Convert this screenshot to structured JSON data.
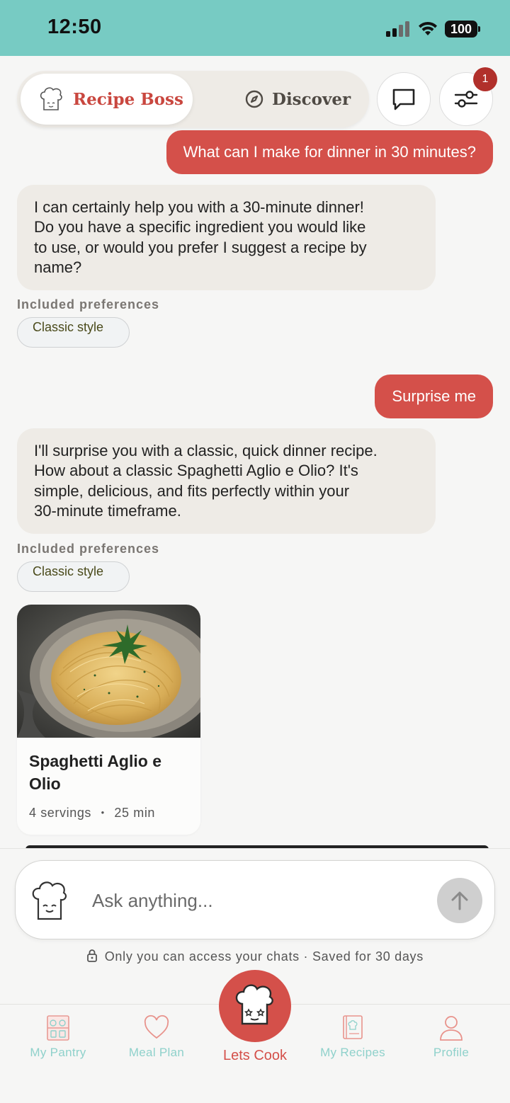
{
  "status_bar": {
    "time": "12:50",
    "battery": "100"
  },
  "header": {
    "tabs": [
      {
        "label": "Recipe Boss",
        "active": true,
        "icon": "chef-hat-icon"
      },
      {
        "label": "Discover",
        "active": false,
        "icon": "compass-icon"
      }
    ],
    "chat_button_icon": "chat-bubble-icon",
    "filter_button_icon": "sliders-icon",
    "filter_badge": "1"
  },
  "conversation": [
    {
      "role": "user",
      "text": "What can I make for dinner in 30 minutes?"
    },
    {
      "role": "assistant",
      "lines": [
        "I can certainly help you with a 30-minute dinner!",
        "Do you have a specific ingredient you would like",
        "to use, or would you prefer I suggest a recipe by",
        "name?"
      ],
      "preferences_title": "Included preferences",
      "preferences": [
        "Classic style"
      ]
    },
    {
      "role": "user",
      "text": "Surprise me"
    },
    {
      "role": "assistant",
      "lines": [
        "I'll surprise you with a classic, quick dinner recipe.",
        "How about a classic Spaghetti Aglio e Olio? It's",
        "simple, delicious, and fits perfectly within your",
        "30-minute timeframe."
      ],
      "preferences_title": "Included preferences",
      "preferences": [
        "Classic style"
      ]
    }
  ],
  "recipe_card": {
    "title": "Spaghetti Aglio e Olio",
    "servings": "4 servings",
    "separator": "•",
    "time": "25 min"
  },
  "composer": {
    "placeholder": "Ask anything...",
    "send_icon": "arrow-up-icon",
    "privacy_note": "Only you can access your chats · Saved for 30 days"
  },
  "tabbar": {
    "items": [
      {
        "label": "My Pantry",
        "icon": "pantry-icon"
      },
      {
        "label": "Meal Plan",
        "icon": "heart-icon"
      },
      {
        "label": "Lets Cook",
        "icon": "chef-hat-icon",
        "active": true
      },
      {
        "label": "My Recipes",
        "icon": "recipe-book-icon"
      },
      {
        "label": "Profile",
        "icon": "person-icon"
      }
    ]
  },
  "colors": {
    "accent": "#d4504a",
    "status_bar": "#77cbc3",
    "tab_inactive": "#8fd1cb",
    "bubble_bot": "#eeebe6"
  }
}
